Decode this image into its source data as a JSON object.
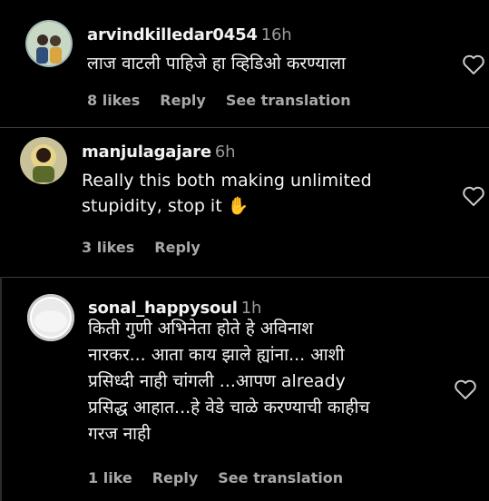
{
  "comments": [
    {
      "username": "arvindkilledar0454",
      "time": "16h",
      "text": "लाज वाटली पाहिजे हा व्हिडिओ करण्याला",
      "likes": "8 likes",
      "reply": "Reply",
      "translation": "See translation"
    },
    {
      "username": "manjulagajare",
      "time": "6h",
      "text": "Really this both making unlimited\nstupidity, stop it ✋",
      "likes": "3 likes",
      "reply": "Reply"
    },
    {
      "username": "sonal_happysoul",
      "time": "1h",
      "text": "किती गुणी अभिनेता होते हे अविनाश\nनारकर... आता काय झाले ह्यांना... आशी\nप्रसिध्दी नाही चांगली ...आपण already\nप्रसिद्ध आहात...हे वेडे चाळे करण्याची काहीच\nगरज नाही",
      "likes": "1 like",
      "reply": "Reply",
      "translation": "See translation"
    }
  ],
  "icons": {
    "heart": "heart-outline-icon",
    "avatar_default": "default-avatar-icon"
  },
  "colors": {
    "background": "#000000",
    "text": "#f5f5f5",
    "secondary": "#a8a8a8"
  }
}
